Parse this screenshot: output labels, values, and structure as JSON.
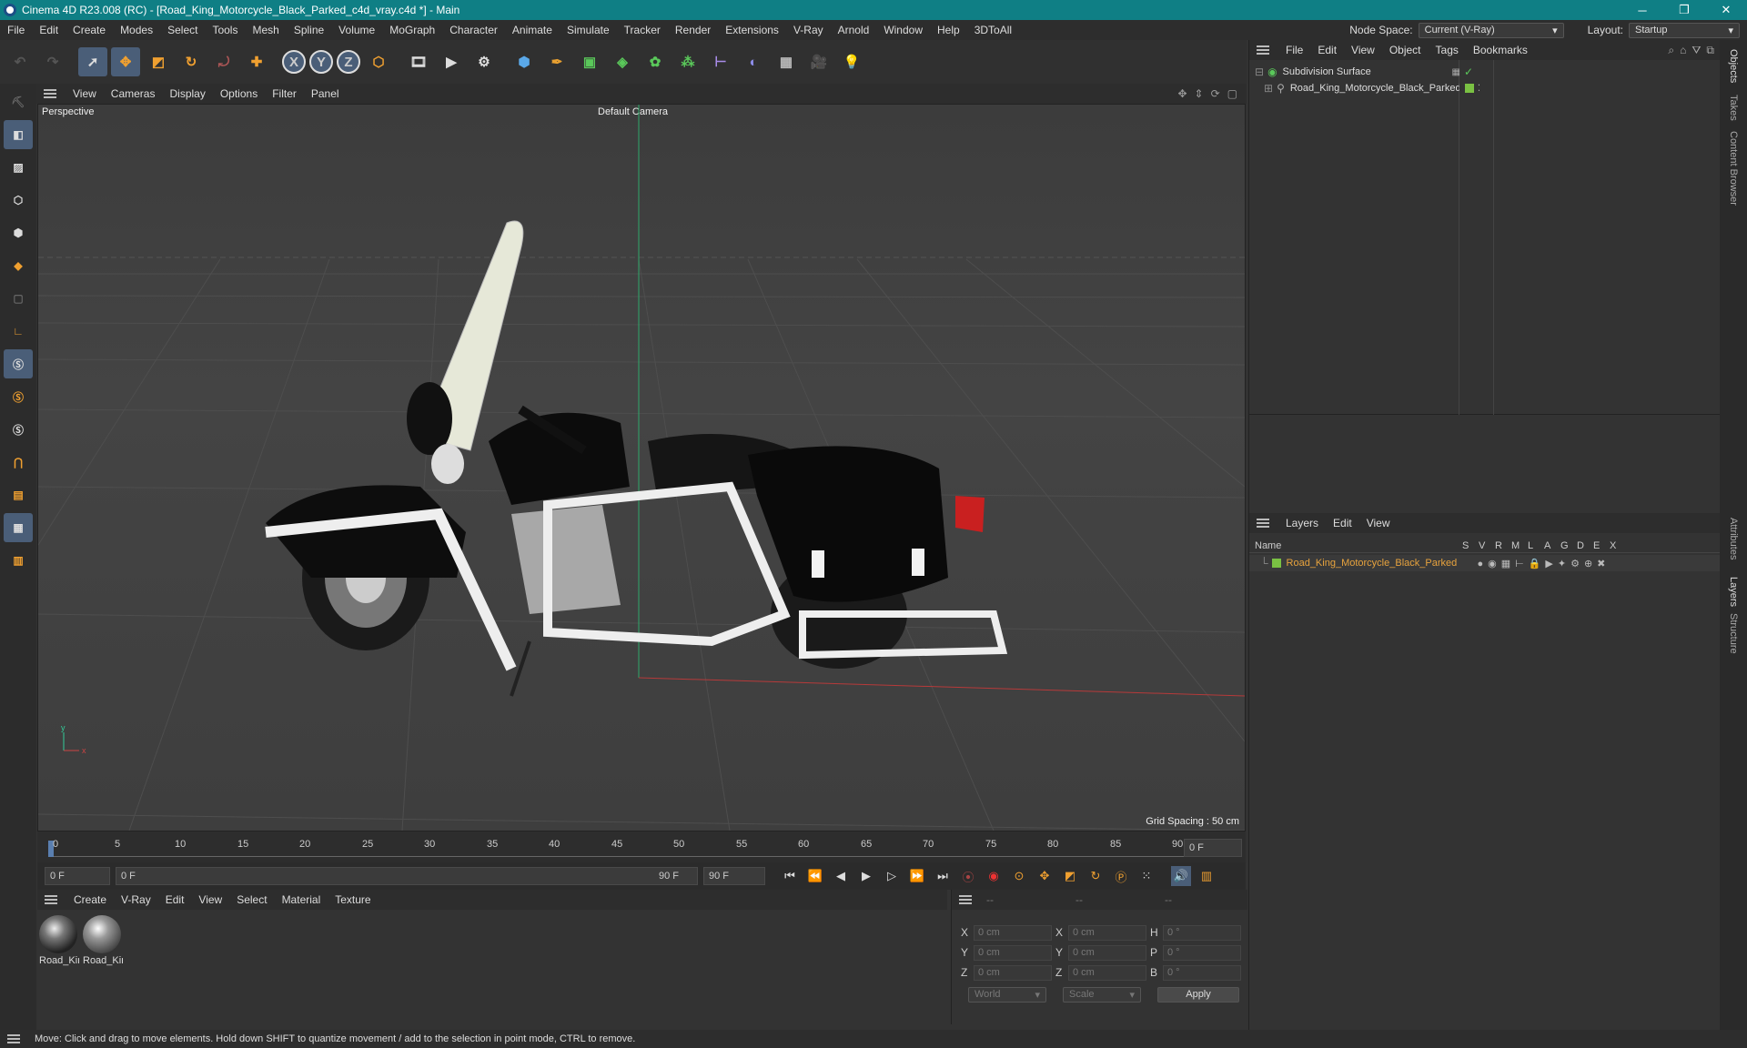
{
  "window": {
    "title": "Cinema 4D R23.008 (RC) - [Road_King_Motorcycle_Black_Parked_c4d_vray.c4d *] - Main",
    "minimize": "─",
    "maximize": "❐",
    "close": "✕"
  },
  "menubar": {
    "items": [
      "File",
      "Edit",
      "Create",
      "Modes",
      "Select",
      "Tools",
      "Mesh",
      "Spline",
      "Volume",
      "MoGraph",
      "Character",
      "Animate",
      "Simulate",
      "Tracker",
      "Render",
      "Extensions",
      "V-Ray",
      "Arnold",
      "Window",
      "Help",
      "3DToAll"
    ],
    "node_space_label": "Node Space:",
    "node_space_value": "Current (V-Ray)",
    "layout_label": "Layout:",
    "layout_value": "Startup"
  },
  "toolbar": {
    "icons": [
      "undo-icon",
      "redo-icon",
      "select-arrow-icon",
      "move-icon",
      "scale-icon",
      "rotate-icon",
      "recent-tool-icon",
      "create-object-icon",
      "x-axis-icon",
      "y-axis-icon",
      "z-axis-icon",
      "coordinate-system-icon",
      "render-region-icon",
      "render-view-icon",
      "render-settings-icon",
      "cube-icon",
      "pen-icon",
      "subdivision-icon",
      "extrude-icon",
      "cloner-icon",
      "array-icon",
      "deformer-icon",
      "field-icon",
      "floor-icon",
      "camera-icon",
      "light-icon"
    ],
    "x": "X",
    "y": "Y",
    "z": "Z"
  },
  "viewport": {
    "menu": [
      "View",
      "Cameras",
      "Display",
      "Options",
      "Filter",
      "Panel"
    ],
    "view_name": "Perspective",
    "camera": "Default Camera",
    "grid_spacing": "Grid Spacing : 50 cm",
    "axis_y": "y",
    "axis_x": "x"
  },
  "timeline": {
    "ticks": [
      "0",
      "5",
      "10",
      "15",
      "20",
      "25",
      "30",
      "35",
      "40",
      "45",
      "50",
      "55",
      "60",
      "65",
      "70",
      "75",
      "80",
      "85",
      "90"
    ],
    "current_frame": "0 F",
    "start_field": "0 F",
    "range_start": "0 F",
    "range_end": "90 F",
    "end_field": "90 F"
  },
  "material_manager": {
    "menu": [
      "Create",
      "V-Ray",
      "Edit",
      "View",
      "Select",
      "Material",
      "Texture"
    ],
    "materials": [
      {
        "label": "Road_Kir"
      },
      {
        "label": "Road_Kir"
      }
    ]
  },
  "coordinates": {
    "headers": [
      "--",
      "--",
      "--"
    ],
    "rows": [
      {
        "a": "X",
        "av": "0 cm",
        "b": "X",
        "bv": "0 cm",
        "c": "H",
        "cv": "0 °"
      },
      {
        "a": "Y",
        "av": "0 cm",
        "b": "Y",
        "bv": "0 cm",
        "c": "P",
        "cv": "0 °"
      },
      {
        "a": "Z",
        "av": "0 cm",
        "b": "Z",
        "bv": "0 cm",
        "c": "B",
        "cv": "0 °"
      }
    ],
    "mode": "World",
    "transform": "Scale",
    "apply": "Apply"
  },
  "object_manager": {
    "menu": [
      "File",
      "Edit",
      "View",
      "Object",
      "Tags",
      "Bookmarks"
    ],
    "objects": [
      {
        "name": "Subdivision Surface"
      },
      {
        "name": "Road_King_Motorcycle_Black_Parked"
      }
    ]
  },
  "layer_manager": {
    "menu": [
      "Layers",
      "Edit",
      "View"
    ],
    "name_header": "Name",
    "flags": [
      "S",
      "V",
      "R",
      "M",
      "L",
      "A",
      "G",
      "D",
      "E",
      "X"
    ],
    "layers": [
      {
        "name": "Road_King_Motorcycle_Black_Parked"
      }
    ]
  },
  "side_tabs": [
    "Objects",
    "Takes",
    "Content Browser",
    "Attributes",
    "Layers",
    "Structure"
  ],
  "status": {
    "text": "Move: Click and drag to move elements. Hold down SHIFT to quantize movement / add to the selection in point mode, CTRL to remove."
  },
  "colors": {
    "titlebar": "#0f7f85",
    "accent": "#4a5e78",
    "layer_text": "#e8a33d",
    "layer_swatch": "#7ac143"
  }
}
